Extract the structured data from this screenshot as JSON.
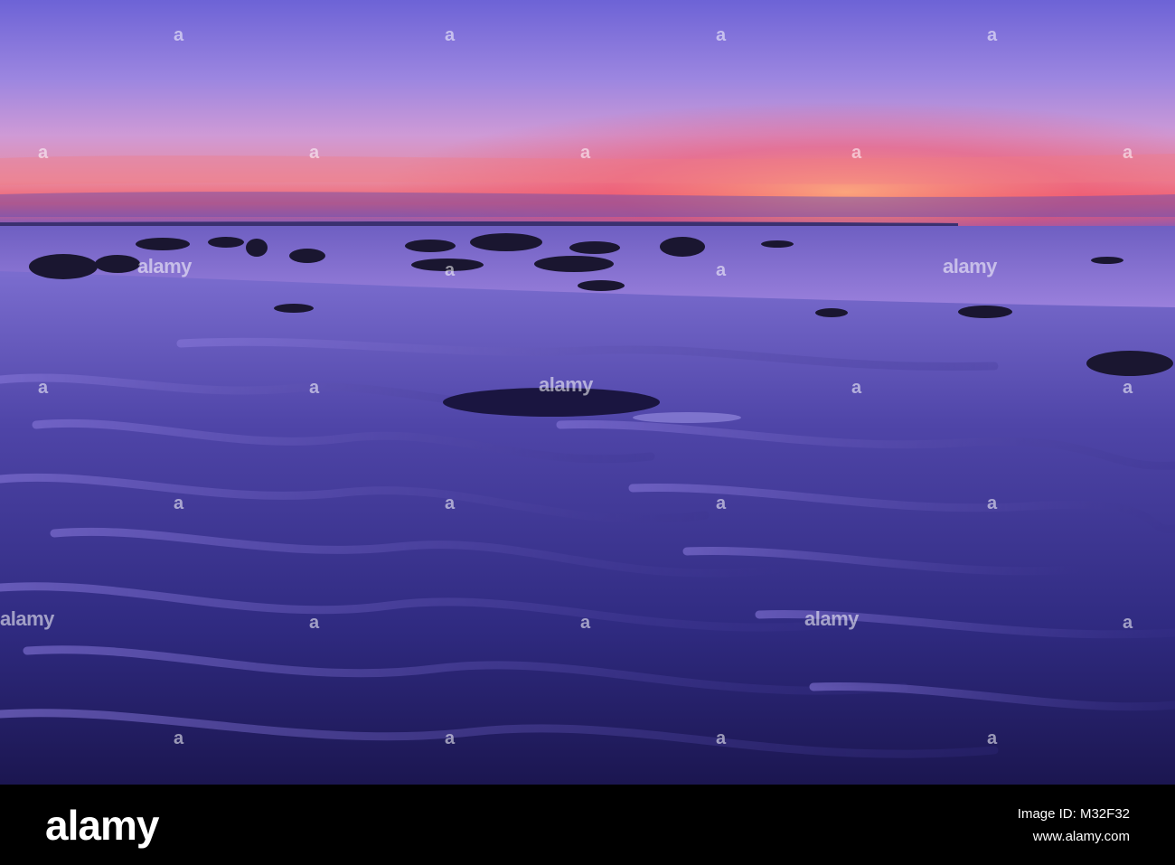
{
  "scene": {
    "subject": "low tide rippled sand beach with rocks at dusk",
    "colors": {
      "sky_top": "#7a6bd8",
      "sky_mid": "#d79ad3",
      "horizon_glow": "#f0506a",
      "sea": "#8b73d6",
      "sand_dark": "#1f1850",
      "sand_light": "#6a5fc4",
      "rock": "#1a1630"
    }
  },
  "watermark": {
    "text": "alamy",
    "icon": "alamy-a-icon"
  },
  "footer": {
    "brand": "alamy",
    "image_id_label": "Image ID: M32F32",
    "site": "www.alamy.com"
  }
}
